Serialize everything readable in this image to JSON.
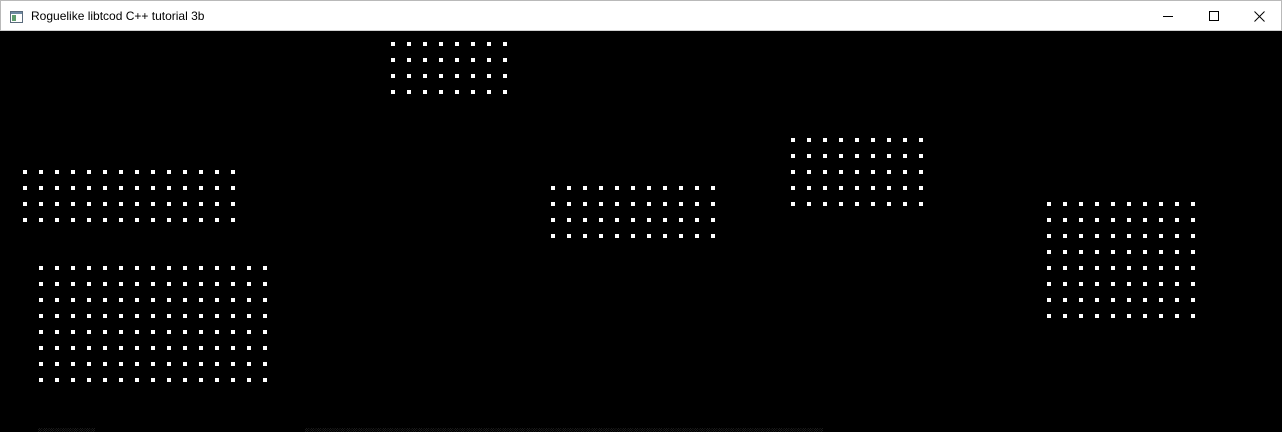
{
  "window": {
    "title": "Roguelike libtcod C++ tutorial 3b",
    "icon": "app-window-icon",
    "controls": [
      "minimize-icon",
      "maximize-icon",
      "close-icon"
    ]
  },
  "map": {
    "background_color": "#000000",
    "floor_color": "#ffffff",
    "floor_glyph": "."
  }
}
